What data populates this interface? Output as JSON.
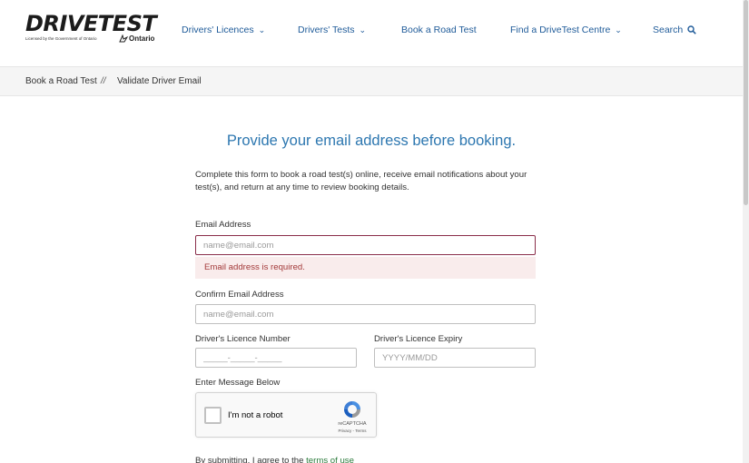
{
  "header": {
    "logo_text": "DRIVETEST",
    "logo_subtext": "Licensed by the Government of Ontario",
    "logo_ontario": "Ontario",
    "nav": [
      {
        "label": "Drivers' Licences",
        "has_dropdown": true
      },
      {
        "label": "Drivers' Tests",
        "has_dropdown": true
      },
      {
        "label": "Book a Road Test",
        "has_dropdown": false
      },
      {
        "label": "Find a DriveTest Centre",
        "has_dropdown": true
      },
      {
        "label": "Search",
        "icon": "search-icon"
      }
    ]
  },
  "breadcrumb": {
    "items": [
      "Book a Road Test",
      "Validate Driver Email"
    ],
    "separator": "//"
  },
  "main": {
    "title": "Provide your email address before booking.",
    "intro": "Complete this form to book a road test(s) online, receive email notifications about your test(s), and return at any time to review booking details.",
    "email": {
      "label": "Email Address",
      "placeholder": "name@email.com",
      "value": "",
      "error": "Email address is required."
    },
    "confirm_email": {
      "label": "Confirm Email Address",
      "placeholder": "name@email.com",
      "value": ""
    },
    "licence_number": {
      "label": "Driver's Licence Number",
      "placeholder": "_____-_____-_____",
      "value": ""
    },
    "licence_expiry": {
      "label": "Driver's Licence Expiry",
      "placeholder": "YYYY/MM/DD",
      "value": ""
    },
    "captcha": {
      "section_label": "Enter Message Below",
      "checkbox_label": "I'm not a robot",
      "brand": "reCAPTCHA",
      "links": "Privacy - Terms"
    },
    "submit_note": {
      "prefix": "By submitting, I agree to the ",
      "link": "terms of use"
    }
  },
  "colors": {
    "accent_blue": "#2d77b0",
    "nav_blue": "#1f5b99",
    "error_text": "#a33a3a",
    "error_bg": "#f9ecec",
    "error_border": "#8a2e4a",
    "link_green": "#2b7a3b"
  }
}
